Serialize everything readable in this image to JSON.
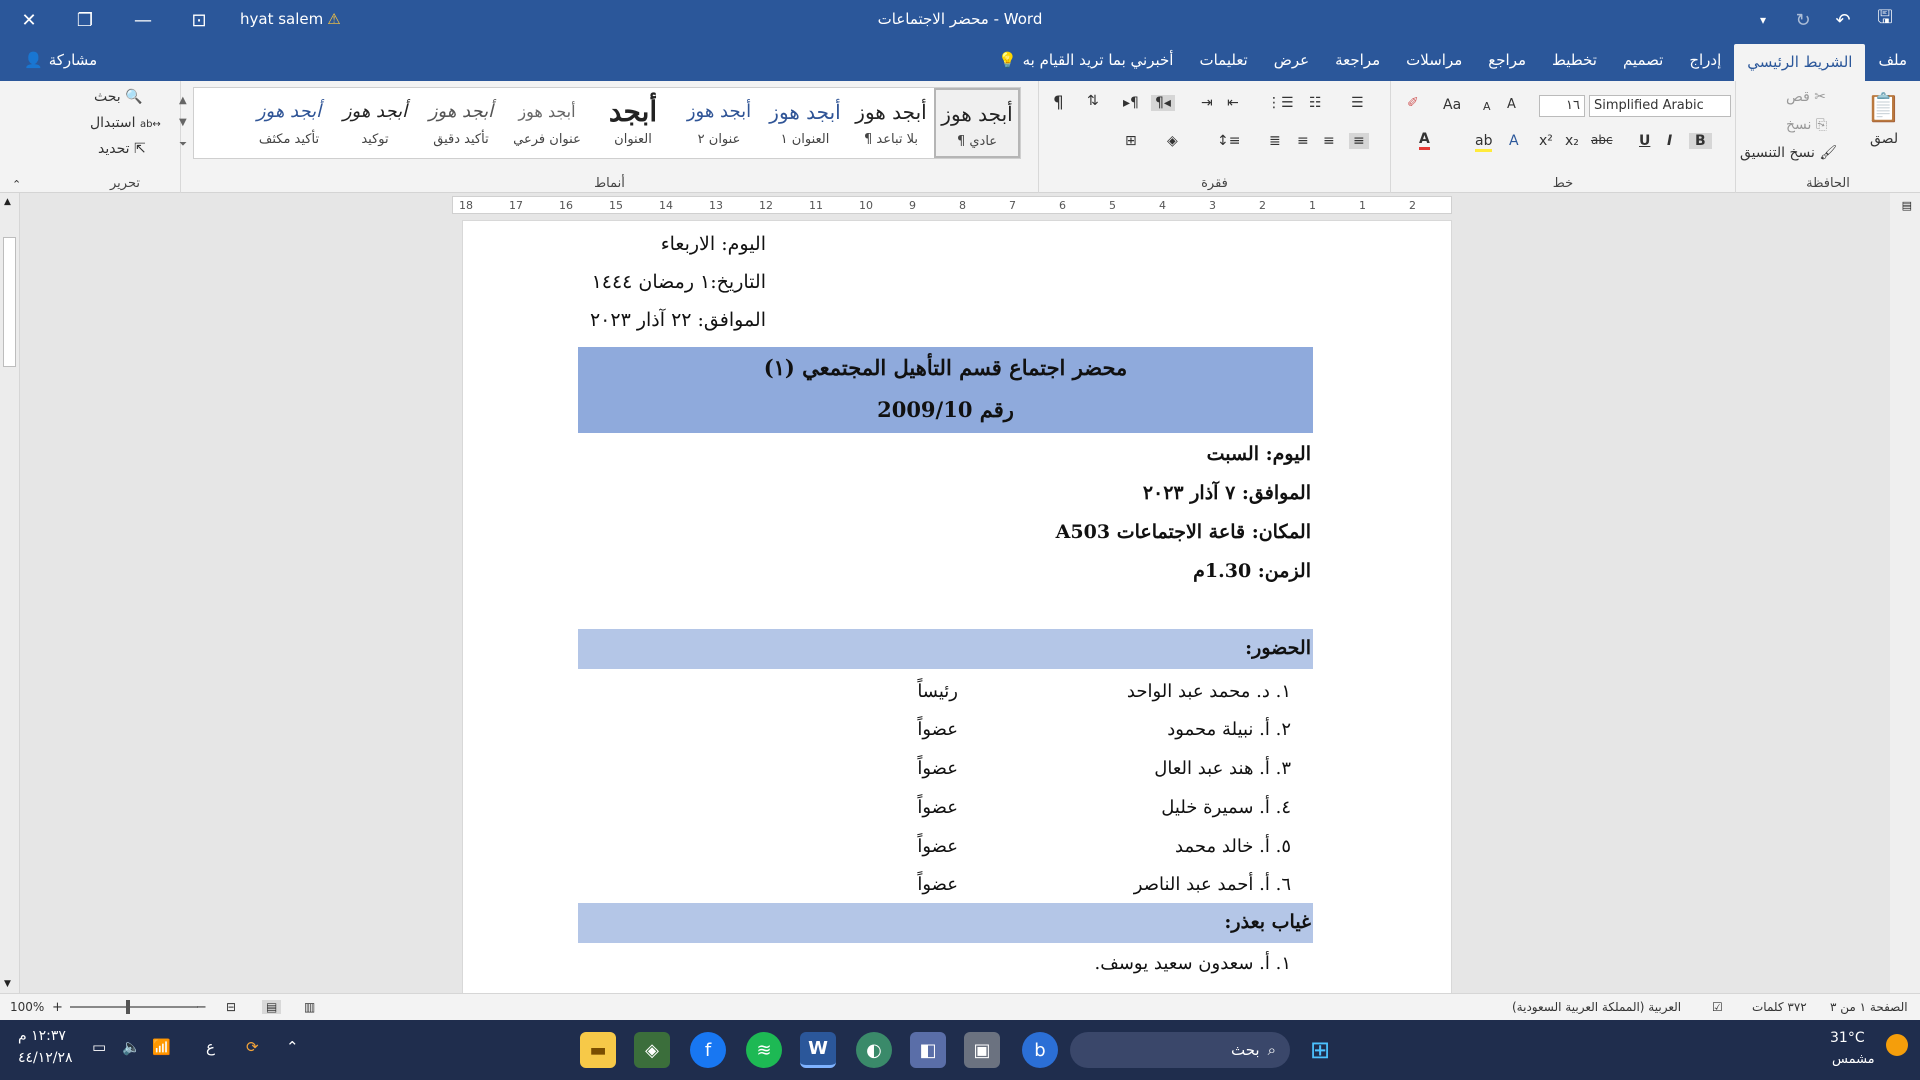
{
  "titlebar": {
    "doc_title": "محضر الاجتماعات",
    "app": "Word",
    "separator": "-",
    "user": "hyat salem",
    "warning_icon": "warning-icon"
  },
  "tabs": {
    "file": "ملف",
    "home": "الشريط الرئيسي",
    "insert": "إدراج",
    "design": "تصميم",
    "layout": "تخطيط",
    "references": "مراجع",
    "mailings": "مراسلات",
    "review": "مراجعة",
    "view": "عرض",
    "help": "تعليمات",
    "tell_me": "أخبرني بما تريد القيام به",
    "share": "مشاركة"
  },
  "ribbon": {
    "clipboard": {
      "label": "الحافظة",
      "paste": "لصق",
      "cut": "قص",
      "copy": "نسخ",
      "format_painter": "نسخ التنسيق"
    },
    "font": {
      "label": "خط",
      "name": "Simplified Arabic",
      "size": "١٦",
      "case": "Aa",
      "bold": "B",
      "italic": "I",
      "underline": "U",
      "strike": "abc",
      "sub": "x₂",
      "sup": "x²",
      "grow": "A",
      "shrink": "A",
      "effects": "A",
      "font_color": "A"
    },
    "paragraph": {
      "label": "فقرة"
    },
    "styles": {
      "label": "أنماط",
      "items": [
        {
          "preview": "أبجد هوز",
          "name": "¶ عادي"
        },
        {
          "preview": "أبجد هوز",
          "name": "¶ بلا تباعد"
        },
        {
          "preview": "أبجد هوز",
          "name": "العنوان ١"
        },
        {
          "preview": "أبجد هوز",
          "name": "عنوان ٢"
        },
        {
          "preview": "أبجد",
          "name": "العنوان"
        },
        {
          "preview": "أبجد هوز",
          "name": "عنوان فرعي"
        },
        {
          "preview": "أبجد هوز",
          "name": "تأكيد دقيق"
        },
        {
          "preview": "أبجد هوز",
          "name": "توكيد"
        },
        {
          "preview": "أبجد هوز",
          "name": "تأكيد مكثف"
        }
      ]
    },
    "editing": {
      "label": "تحرير",
      "find": "بحث",
      "replace": "استبدال",
      "select": "تحديد"
    }
  },
  "ruler": {
    "ticks": [
      "18",
      "17",
      "16",
      "15",
      "14",
      "13",
      "12",
      "11",
      "10",
      "9",
      "8",
      "7",
      "6",
      "5",
      "4",
      "3",
      "2",
      "1",
      "1",
      "2"
    ]
  },
  "document": {
    "day_line": "اليوم: الاربعاء",
    "date_line": "التاريخ:١ رمضان ١٤٤٤",
    "corr_line": "الموافق: ٢٢ آذار ٢٠٢٣",
    "title": "محضر اجتماع قسم التأهيل المجتمعي (١)",
    "number": "رقم 2009/10",
    "meet_day": "اليوم: السبت",
    "meet_date": "الموافق: ٧ آذار ٢٠٢٣",
    "meet_place": "المكان: قاعة الاجتماعات A503",
    "meet_time": "الزمن: 1.30م",
    "attendance_header": "الحضور:",
    "attendees": [
      {
        "name": "١. د. محمد عبد الواحد",
        "role": "رئيساً"
      },
      {
        "name": "٢. أ. نبيلة محمود",
        "role": "عضواً"
      },
      {
        "name": "٣. أ. هند عبد العال",
        "role": "عضواً"
      },
      {
        "name": "٤. أ. سميرة خليل",
        "role": "عضواً"
      },
      {
        "name": "٥. أ. خالد محمد",
        "role": "عضواً"
      },
      {
        "name": "٦. أ. أحمد عبد الناصر",
        "role": "عضواً"
      }
    ],
    "absence_header": "غياب بعذر:",
    "absentees": [
      {
        "name": "١. أ. سعدون سعيد يوسف."
      }
    ]
  },
  "statusbar": {
    "page": "الصفحة ١ من ٣",
    "words": "٣٧٢ كلمات",
    "language": "العربية (المملكة العربية السعودية)",
    "zoom": "100%"
  },
  "taskbar": {
    "weather_temp": "31°C",
    "weather_desc": "مشمس",
    "search_placeholder": "بحث",
    "time": "١٢:٣٧ م",
    "date": "٤٤/١٢/٢٨",
    "lang": "ع"
  },
  "colors": {
    "word_blue": "#2b579a",
    "banner_dark": "#8faadc",
    "banner_light": "#b4c6e7"
  }
}
